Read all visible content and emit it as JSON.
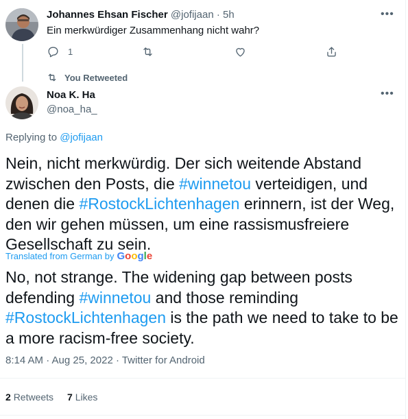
{
  "parent_tweet": {
    "author_name": "Johannes Ehsan Fischer",
    "handle": "@jofijaan",
    "separator": "·",
    "time": "5h",
    "text": "Ein merkwürdiger Zusammenhang nicht wahr?",
    "reply_count": "1",
    "more_label": "•••"
  },
  "retweet_context": {
    "label": "You Retweeted"
  },
  "main_tweet": {
    "author_name": "Noa K. Ha",
    "handle": "@noa_ha_",
    "more_label": "•••",
    "replying_prefix": "Replying to",
    "replying_handle": "@jofijaan",
    "text_parts": {
      "a": "Nein, nicht merkwürdig. Der sich weitende Abstand zwischen den Posts, die ",
      "tag1": "#winnetou",
      "b": " verteidigen, und denen die ",
      "tag2": "#RostockLichtenhagen",
      "c": " erinnern, ist der Weg, den wir gehen müssen, um eine rassismusfreiere Gesellschaft zu sein."
    },
    "translated_label": "Translated from German by",
    "translator": "Google",
    "translation_parts": {
      "a": "No, not strange. The widening gap between posts defending ",
      "tag1": "#winnetou",
      "b": " and those reminding ",
      "tag2": "#RostockLichtenhagen",
      "c": " is the path we need to take to be a more racism-free society."
    },
    "timestamp": "8:14 AM · Aug 25, 2022 · Twitter for Android",
    "retweets_count": "2",
    "retweets_label": "Retweets",
    "likes_count": "7",
    "likes_label": "Likes"
  },
  "colors": {
    "accent": "#1d9bf0",
    "muted": "#536471",
    "text": "#0f1419",
    "divider": "#eff3f4",
    "google_blue": "#4285f4",
    "google_red": "#ea4335",
    "google_yellow": "#fbbc05",
    "google_green": "#34a853"
  },
  "icons": {
    "reply": "reply-icon",
    "retweet": "retweet-icon",
    "like": "heart-icon",
    "share": "share-icon"
  }
}
